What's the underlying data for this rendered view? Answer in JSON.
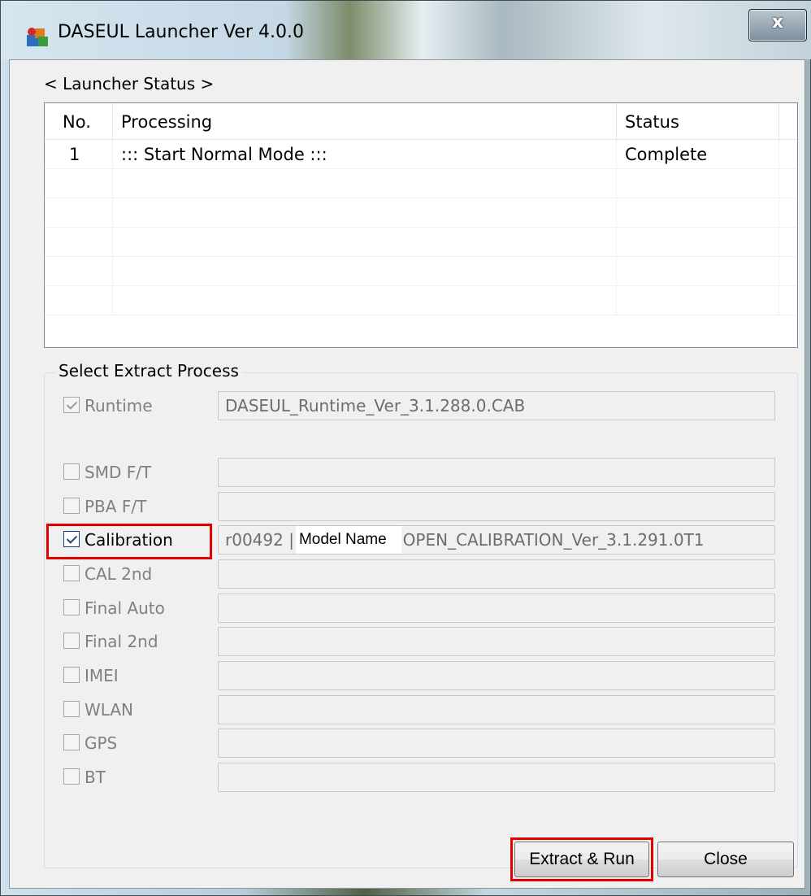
{
  "window": {
    "title": "DASEUL Launcher Ver 4.0.0",
    "close_symbol": "x",
    "app_icon": "daseul-app-icon"
  },
  "status": {
    "label": "< Launcher Status >",
    "columns": [
      "No.",
      "Processing",
      "Status"
    ],
    "rows": [
      {
        "no": "1",
        "processing": "::: Start Normal Mode :::",
        "status": "Complete"
      },
      {
        "no": "",
        "processing": "",
        "status": ""
      },
      {
        "no": "",
        "processing": "",
        "status": ""
      },
      {
        "no": "",
        "processing": "",
        "status": ""
      },
      {
        "no": "",
        "processing": "",
        "status": ""
      },
      {
        "no": "",
        "processing": "",
        "status": ""
      }
    ]
  },
  "extract": {
    "group_title": "Select Extract Process",
    "items": [
      {
        "label": "Runtime",
        "checked": true,
        "enabled": false,
        "value": "DASEUL_Runtime_Ver_3.1.288.0.CAB"
      },
      {
        "label": "SMD F/T",
        "checked": false,
        "enabled": false,
        "value": ""
      },
      {
        "label": "PBA F/T",
        "checked": false,
        "enabled": false,
        "value": ""
      },
      {
        "label": "Calibration",
        "checked": true,
        "enabled": true,
        "value_prefix": "r00492 |",
        "value_model": "Model Name",
        "value_suffix": "OPEN_CALIBRATION_Ver_3.1.291.0T1"
      },
      {
        "label": "CAL 2nd",
        "checked": false,
        "enabled": false,
        "value": ""
      },
      {
        "label": "Final Auto",
        "checked": false,
        "enabled": false,
        "value": ""
      },
      {
        "label": "Final 2nd",
        "checked": false,
        "enabled": false,
        "value": ""
      },
      {
        "label": "IMEI",
        "checked": false,
        "enabled": false,
        "value": ""
      },
      {
        "label": "WLAN",
        "checked": false,
        "enabled": false,
        "value": ""
      },
      {
        "label": "GPS",
        "checked": false,
        "enabled": false,
        "value": ""
      },
      {
        "label": "BT",
        "checked": false,
        "enabled": false,
        "value": ""
      }
    ]
  },
  "buttons": {
    "extract_run": "Extract & Run",
    "close": "Close"
  },
  "colors": {
    "highlight": "#e00000"
  }
}
